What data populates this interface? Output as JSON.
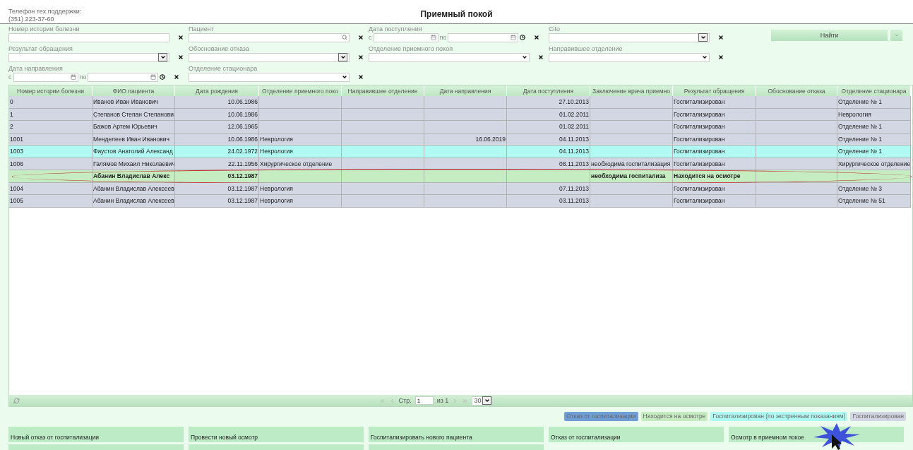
{
  "header": {
    "support_label": "Телефон тех.поддержки:",
    "support_phone": "(351) 223-37-60",
    "title": "Приемный покой"
  },
  "filters": [
    {
      "label": "Номер истории болезни",
      "kind": "text"
    },
    {
      "label": "Пациент",
      "kind": "search"
    },
    {
      "label": "Дата поступления",
      "kind": "date-range",
      "from_label": "с",
      "to_label": "по"
    },
    {
      "label": "Cito",
      "kind": "select"
    },
    {
      "label": "Результат обращения",
      "kind": "select"
    },
    {
      "label": "Обоснование отказа",
      "kind": "select"
    },
    {
      "label": "Отделение приемного покоя",
      "kind": "combo"
    },
    {
      "label": "Направившее отделение",
      "kind": "combo"
    },
    {
      "label": "Дата направления",
      "kind": "date-range",
      "from_label": "с",
      "to_label": "по"
    },
    {
      "label": "Отделение стационара",
      "kind": "combo"
    }
  ],
  "find_button": "Найти",
  "table": {
    "columns": [
      {
        "title": "Номер истории болезни",
        "kind": "text"
      },
      {
        "title": "ФИО пациента",
        "kind": "text"
      },
      {
        "title": "Дата рождения",
        "kind": "date"
      },
      {
        "title": "Отделение приемного поко",
        "kind": "text"
      },
      {
        "title": "Направившее отделение",
        "kind": "text"
      },
      {
        "title": "Дата направления",
        "kind": "date"
      },
      {
        "title": "Дата поступления",
        "kind": "date"
      },
      {
        "title": "Заключение врача приемно",
        "kind": "text"
      },
      {
        "title": "Результат обращения",
        "kind": "text"
      },
      {
        "title": "Обоснование отказа",
        "kind": "text"
      },
      {
        "title": "Отделение стационара",
        "kind": "text"
      }
    ],
    "rows": [
      {
        "kind": "hospitalized",
        "circled": false,
        "cells": [
          "0",
          "Иванов Иван Иванович",
          "10.06.1986",
          null,
          null,
          null,
          "27.10.2013",
          null,
          "Госпитализирован",
          null,
          "Отделение № 1"
        ]
      },
      {
        "kind": "hospitalized",
        "circled": false,
        "cells": [
          "1",
          "Степанов Степан Степанови",
          "10.06.1986",
          null,
          null,
          null,
          "01.02.2011",
          null,
          "Госпитализирован",
          null,
          "Неврология"
        ]
      },
      {
        "kind": "hospitalized",
        "circled": false,
        "cells": [
          "2",
          "Бажов Артем Юрьевич",
          "12.06.1965",
          null,
          null,
          null,
          "01.02.2011",
          null,
          "Госпитализирован",
          null,
          "Отделение № 1"
        ]
      },
      {
        "kind": "hospitalized",
        "circled": false,
        "cells": [
          "1001",
          "Менделеев Иван Иванович",
          "10.06.1986",
          "Неврология",
          null,
          "16.06.2019",
          "04.11.2013",
          null,
          "Госпитализирован",
          null,
          "Отделение № 1"
        ]
      },
      {
        "kind": "emergency",
        "circled": false,
        "cells": [
          "1003",
          "Фаустов Анатолий Александ",
          "24.02.1972",
          "Неврология",
          null,
          null,
          "04.11.2013",
          null,
          "Госпитализирован",
          null,
          "Отделение № 1"
        ]
      },
      {
        "kind": "hospitalized",
        "circled": false,
        "cells": [
          "1006",
          "Галямов Михаил Николаевич",
          "22.11.1956",
          "Хирургическое отделение",
          null,
          null,
          "08.11.2013",
          "необходима госпитализация",
          "Госпитализирован",
          null,
          "Хирургическое отделение"
        ]
      },
      {
        "kind": "examination",
        "circled": true,
        "cells": [
          null,
          "Абанин Владислав Алекс",
          "03.12.1987",
          null,
          null,
          null,
          null,
          "необходима госпитализа",
          "Находится на осмотре",
          null,
          null
        ]
      },
      {
        "kind": "hospitalized",
        "circled": false,
        "cells": [
          "1004",
          "Абанин Владислав Алексеев",
          "03.12.1987",
          "Неврология",
          null,
          null,
          "07.11.2013",
          null,
          "Госпитализирован",
          null,
          "Отделение № 3"
        ]
      },
      {
        "kind": "hospitalized",
        "circled": false,
        "cells": [
          "1005",
          "Абанин Владислав Алексеев",
          "03.12.1987",
          "Неврология",
          null,
          null,
          "03.11.2013",
          null,
          "Госпитализирован",
          null,
          "Отделение № 51"
        ]
      }
    ]
  },
  "pager": {
    "page_label": "Стр.",
    "page": "1",
    "of_label": "из 1",
    "page_size": "30"
  },
  "legend": [
    {
      "label": "Отказ от госпитализации",
      "color": "#6f9fd6"
    },
    {
      "label": "Находится на осмотре",
      "color": "#c6ecc2"
    },
    {
      "label": "Госпитализирован (по экстренным показаниям)",
      "color": "#b0faf3"
    },
    {
      "label": "Госпитализирован",
      "color": "#d3d7e4"
    }
  ],
  "actions": [
    "Новый отказ от госпитализации",
    "Провести новый осмотр",
    "Госпитализировать нового пациента",
    "Отказ от госпитализации",
    "Осмотр в приемном покое"
  ]
}
